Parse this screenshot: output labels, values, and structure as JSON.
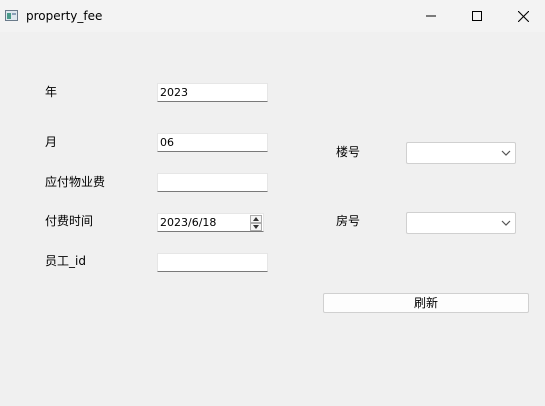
{
  "window": {
    "title": "property_fee",
    "icon": "app-window-icon"
  },
  "form": {
    "year_label": "年",
    "year_value": "2023",
    "month_label": "月",
    "month_value": "06",
    "fee_label": "应付物业费",
    "fee_value": "",
    "paytime_label": "付费时间",
    "paytime_value": "2023/6/18",
    "employee_label": "员工_id",
    "employee_value": "",
    "building_label": "楼号",
    "building_value": "",
    "room_label": "房号",
    "room_value": "",
    "refresh_label": "刷新"
  }
}
